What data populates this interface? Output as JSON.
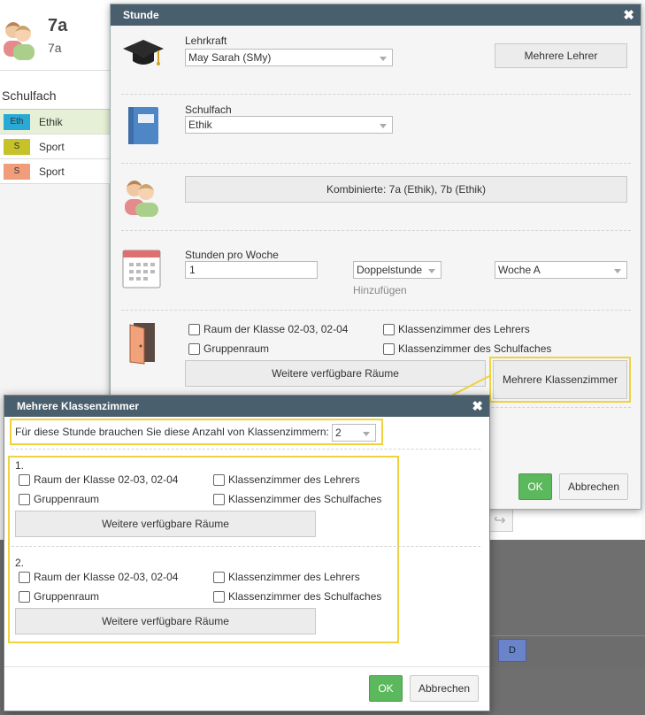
{
  "background": {
    "class_title": "7a",
    "class_subtitle": "7a",
    "subject_heading": "Schulfach",
    "subjects": [
      {
        "badge": "Eth",
        "name": "Ethik",
        "color": "#29a9d6"
      },
      {
        "badge": "S",
        "name": "Sport",
        "color": "#c5c22a"
      },
      {
        "badge": "S",
        "name": "Sport",
        "color": "#ef9d7a"
      }
    ],
    "bottom_badge": "D"
  },
  "dialog": {
    "title": "Stunde",
    "teacher": {
      "label": "Lehrkraft",
      "value": "May Sarah (SMy)",
      "multiple_button": "Mehrere Lehrer"
    },
    "subject": {
      "label": "Schulfach",
      "value": "Ethik"
    },
    "combined_button": "Kombinierte: 7a (Ethik), 7b (Ethik)",
    "hours": {
      "label": "Stunden pro Woche",
      "value": "1",
      "double_select": "Doppelstunde",
      "add_link": "Hinzufügen",
      "week_select": "Woche A"
    },
    "rooms": {
      "opt_class_room": "Raum der Klasse 02-03, 02-04",
      "opt_teacher_room": "Klassenzimmer des Lehrers",
      "opt_group_room": "Gruppenraum",
      "opt_subject_room": "Klassenzimmer des Schulfaches",
      "more_rooms_button": "Weitere verfügbare Räume",
      "multiple_rooms_button": "Mehrere Klassenzimmer"
    },
    "ok": "OK",
    "cancel": "Abbrechen"
  },
  "subdialog": {
    "title": "Mehrere Klassenzimmer",
    "count_label": "Für diese Stunde brauchen Sie diese Anzahl von Klassenzimmern:",
    "count_value": "2",
    "rooms": [
      {
        "number": "1.",
        "opt_class_room": "Raum der Klasse 02-03, 02-04",
        "opt_teacher_room": "Klassenzimmer des Lehrers",
        "opt_group_room": "Gruppenraum",
        "opt_subject_room": "Klassenzimmer des Schulfaches",
        "more_rooms_button": "Weitere verfügbare Räume"
      },
      {
        "number": "2.",
        "opt_class_room": "Raum der Klasse 02-03, 02-04",
        "opt_teacher_room": "Klassenzimmer des Lehrers",
        "opt_group_room": "Gruppenraum",
        "opt_subject_room": "Klassenzimmer des Schulfaches",
        "more_rooms_button": "Weitere verfügbare Räume"
      }
    ],
    "ok": "OK",
    "cancel": "Abbrechen"
  },
  "colors": {
    "titlebar": "#4a5f6d",
    "ok_green": "#5cb85c",
    "highlight_yellow": "#f0d23c"
  }
}
